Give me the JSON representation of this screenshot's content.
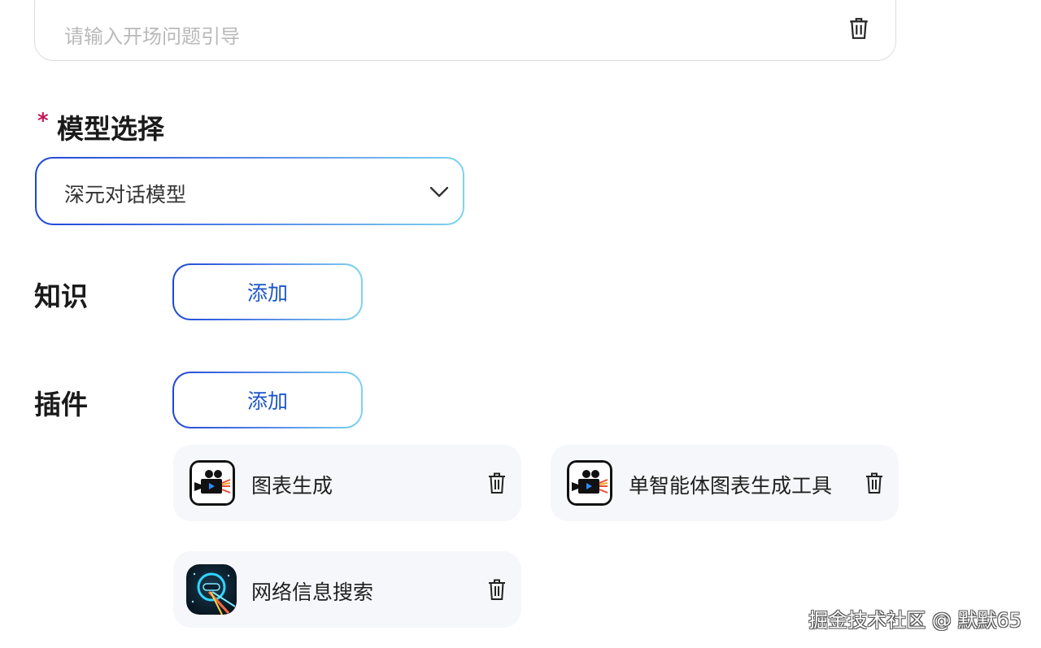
{
  "opening_input": {
    "placeholder": "请输入开场问题引导"
  },
  "model": {
    "label": "模型选择",
    "required_mark": "*",
    "selected": "深元对话模型"
  },
  "knowledge": {
    "label": "知识",
    "add_label": "添加"
  },
  "plugins": {
    "label": "插件",
    "add_label": "添加",
    "items": [
      {
        "name": "图表生成",
        "icon": "movie-camera-icon"
      },
      {
        "name": "单智能体图表生成工具",
        "icon": "movie-camera-icon"
      },
      {
        "name": "网络信息搜索",
        "icon": "robot-search-icon"
      }
    ]
  },
  "watermark": "掘金技术社区 @ 默默65",
  "colors": {
    "accent_blue": "#1c56c9",
    "gradient_start": "#1f47d6",
    "gradient_end": "#7dd3f0",
    "required_star": "#c2185b",
    "card_bg": "#f6f7fa"
  }
}
